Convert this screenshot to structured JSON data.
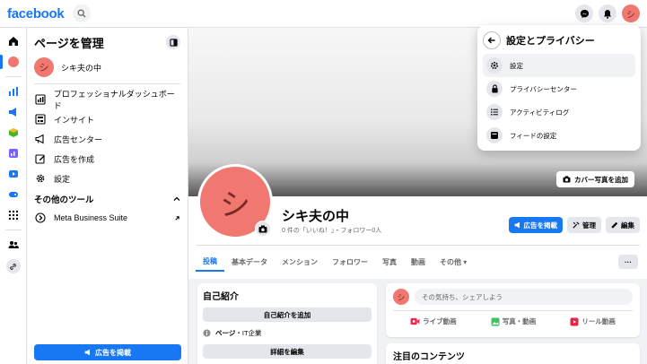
{
  "topbar": {
    "logo": "facebook",
    "avatar_char": "シ"
  },
  "sidebar": {
    "title": "ページを管理",
    "page_name": "シキ夫の中",
    "avatar_char": "シ",
    "items": [
      {
        "label": "プロフェッショナルダッシュボード",
        "icon": "dashboard-icon"
      },
      {
        "label": "インサイト",
        "icon": "insights-icon"
      },
      {
        "label": "広告センター",
        "icon": "megaphone-icon"
      },
      {
        "label": "広告を作成",
        "icon": "edit-icon"
      },
      {
        "label": "設定",
        "icon": "gear-icon"
      }
    ],
    "section_title": "その他のツール",
    "tools": [
      {
        "label": "Meta Business Suite",
        "icon": "meta-icon"
      }
    ],
    "ad_button": "広告を掲載"
  },
  "cover": {
    "add_cover_label": "カバー写真を追加"
  },
  "profile": {
    "avatar_char": "シ",
    "name": "シキ夫の中",
    "subtitle": "0 件の「いいね！」・フォロワー0人",
    "actions": {
      "promote": "広告を掲載",
      "manage": "管理",
      "edit": "編集"
    }
  },
  "tabs": [
    "投稿",
    "基本データ",
    "メンション",
    "フォロワー",
    "写真",
    "動画",
    "その他 ▾"
  ],
  "more_label": "···",
  "intro": {
    "title": "自己紹介",
    "add_bio": "自己紹介を追加",
    "category_label": "ページ",
    "category_value": "・IT企業",
    "edit_details": "詳細を編集"
  },
  "composer": {
    "avatar_char": "シ",
    "placeholder": "その気持ち、シェアしよう",
    "actions": [
      "ライブ動画",
      "写真・動画",
      "リール動画"
    ]
  },
  "featured": {
    "title": "注目のコンテンツ"
  },
  "dropdown": {
    "title": "設定とプライバシー",
    "items": [
      {
        "label": "設定",
        "icon": "gear-icon"
      },
      {
        "label": "プライバシーセンター",
        "icon": "lock-icon"
      },
      {
        "label": "アクティビティログ",
        "icon": "list-icon"
      },
      {
        "label": "フィードの設定",
        "icon": "feed-icon"
      }
    ]
  },
  "colors": {
    "accent": "#1877f2",
    "avatar": "#f07870"
  }
}
